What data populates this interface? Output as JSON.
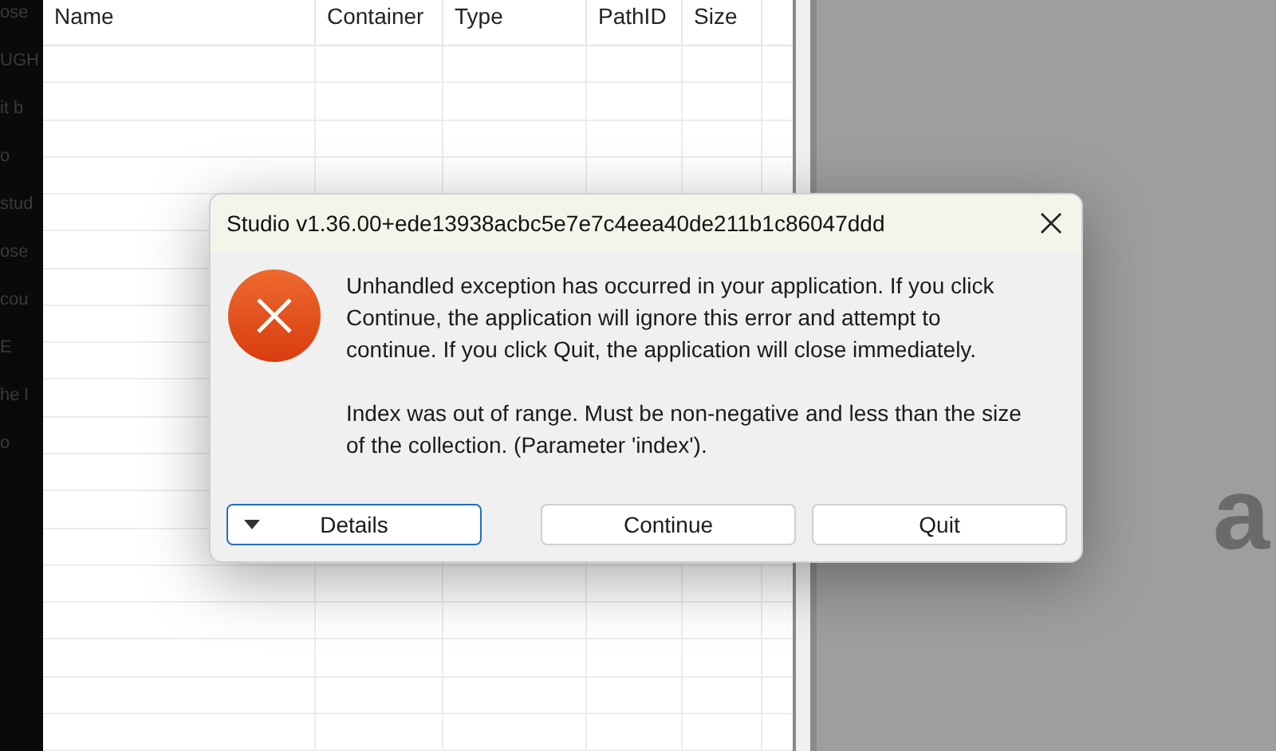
{
  "background_fragments": [
    "ose",
    "UGH",
    "it b",
    "o",
    "stud",
    "ose",
    "cou",
    "E",
    "he l",
    "o"
  ],
  "table": {
    "columns": [
      "Name",
      "Container",
      "Type",
      "PathID",
      "Size"
    ]
  },
  "preview": {
    "text": "a"
  },
  "dialog": {
    "title": "Studio v1.36.00+ede13938acbc5e7e7c4eea40de211b1c86047ddd",
    "paragraphs": [
      "Unhandled exception has occurred in your application. If you click Continue, the application will ignore this error and attempt to continue. If you click Quit, the application will close immediately.",
      "Index was out of range. Must be non-negative and less than the size of the collection. (Parameter 'index')."
    ],
    "buttons": [
      {
        "label": "Details",
        "kind": "expander",
        "selected": true
      },
      {
        "label": "Continue",
        "kind": "plain",
        "selected": false
      },
      {
        "label": "Quit",
        "kind": "plain",
        "selected": false
      }
    ]
  }
}
